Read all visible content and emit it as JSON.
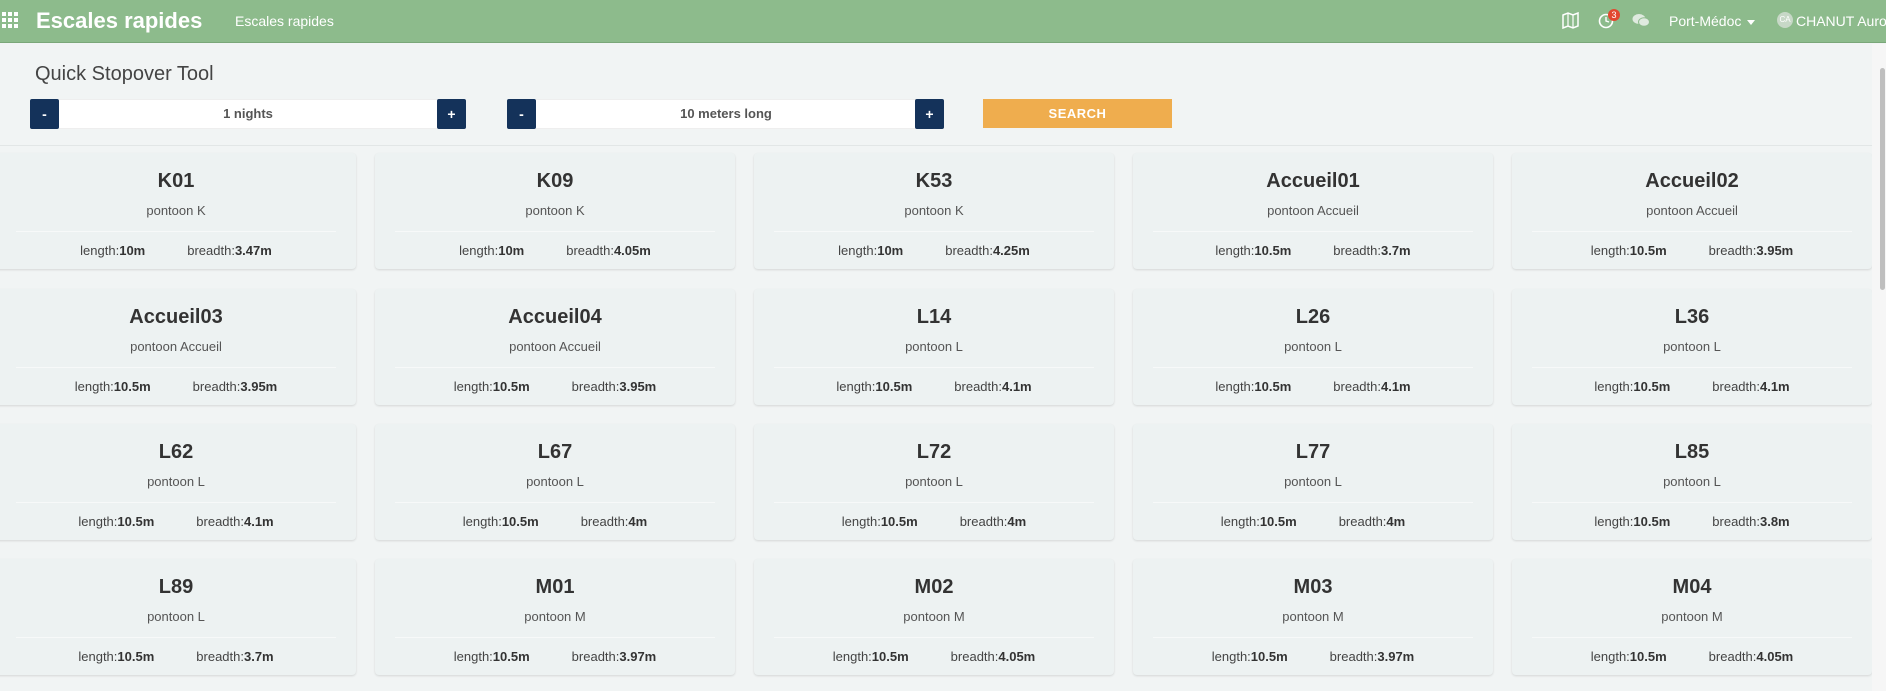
{
  "navbar": {
    "app_title": "Escales rapides",
    "nav_link": "Escales rapides",
    "notification_count": "3",
    "port": "Port-Médoc",
    "user_name": "CHANUT Aurore",
    "avatar_initials": "CA",
    "icons": [
      "apps-grid-icon",
      "map-icon",
      "clock-icon",
      "chat-icon"
    ]
  },
  "toolbar": {
    "title": "Quick Stopover Tool",
    "nights_value": "1 nights",
    "length_value": "10 meters long",
    "minus_label": "-",
    "plus_label": "+",
    "search_label": "SEARCH"
  },
  "labels": {
    "length": "length:",
    "breadth": "breadth:"
  },
  "berths": [
    {
      "name": "K01",
      "pontoon": "pontoon K",
      "length": "10m",
      "breadth": "3.47m"
    },
    {
      "name": "K09",
      "pontoon": "pontoon K",
      "length": "10m",
      "breadth": "4.05m"
    },
    {
      "name": "K53",
      "pontoon": "pontoon K",
      "length": "10m",
      "breadth": "4.25m"
    },
    {
      "name": "Accueil01",
      "pontoon": "pontoon Accueil",
      "length": "10.5m",
      "breadth": "3.7m"
    },
    {
      "name": "Accueil02",
      "pontoon": "pontoon Accueil",
      "length": "10.5m",
      "breadth": "3.95m"
    },
    {
      "name": "Accueil03",
      "pontoon": "pontoon Accueil",
      "length": "10.5m",
      "breadth": "3.95m"
    },
    {
      "name": "Accueil04",
      "pontoon": "pontoon Accueil",
      "length": "10.5m",
      "breadth": "3.95m"
    },
    {
      "name": "L14",
      "pontoon": "pontoon L",
      "length": "10.5m",
      "breadth": "4.1m"
    },
    {
      "name": "L26",
      "pontoon": "pontoon L",
      "length": "10.5m",
      "breadth": "4.1m"
    },
    {
      "name": "L36",
      "pontoon": "pontoon L",
      "length": "10.5m",
      "breadth": "4.1m"
    },
    {
      "name": "L62",
      "pontoon": "pontoon L",
      "length": "10.5m",
      "breadth": "4.1m"
    },
    {
      "name": "L67",
      "pontoon": "pontoon L",
      "length": "10.5m",
      "breadth": "4m"
    },
    {
      "name": "L72",
      "pontoon": "pontoon L",
      "length": "10.5m",
      "breadth": "4m"
    },
    {
      "name": "L77",
      "pontoon": "pontoon L",
      "length": "10.5m",
      "breadth": "4m"
    },
    {
      "name": "L85",
      "pontoon": "pontoon L",
      "length": "10.5m",
      "breadth": "3.8m"
    },
    {
      "name": "L89",
      "pontoon": "pontoon L",
      "length": "10.5m",
      "breadth": "3.7m"
    },
    {
      "name": "M01",
      "pontoon": "pontoon M",
      "length": "10.5m",
      "breadth": "3.97m"
    },
    {
      "name": "M02",
      "pontoon": "pontoon M",
      "length": "10.5m",
      "breadth": "4.05m"
    },
    {
      "name": "M03",
      "pontoon": "pontoon M",
      "length": "10.5m",
      "breadth": "3.97m"
    },
    {
      "name": "M04",
      "pontoon": "pontoon M",
      "length": "10.5m",
      "breadth": "4.05m"
    }
  ],
  "colors": {
    "navbar": "#8dbb8c",
    "stepper_button": "#14325a",
    "search_button": "#efad4e",
    "badge": "#e2482f"
  }
}
